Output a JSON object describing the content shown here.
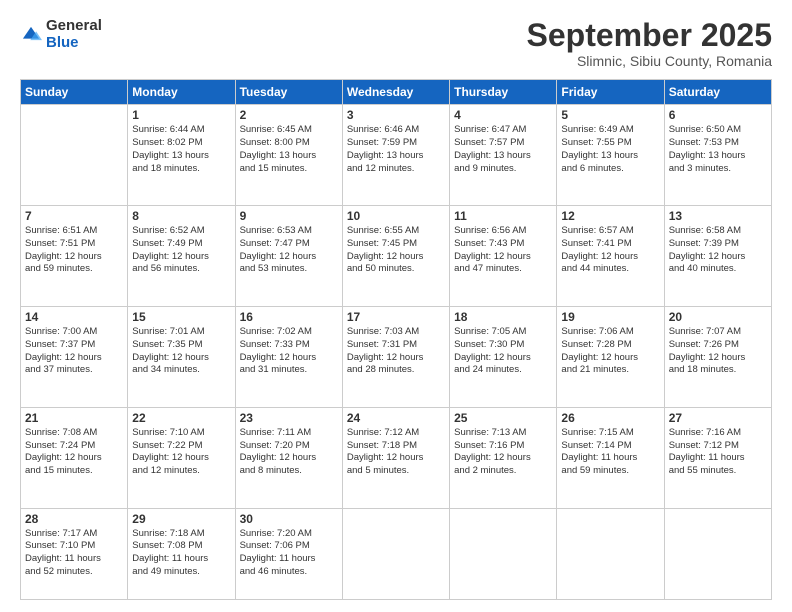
{
  "logo": {
    "general": "General",
    "blue": "Blue"
  },
  "title": "September 2025",
  "location": "Slimnic, Sibiu County, Romania",
  "weekdays": [
    "Sunday",
    "Monday",
    "Tuesday",
    "Wednesday",
    "Thursday",
    "Friday",
    "Saturday"
  ],
  "weeks": [
    [
      {
        "day": "",
        "info": ""
      },
      {
        "day": "1",
        "info": "Sunrise: 6:44 AM\nSunset: 8:02 PM\nDaylight: 13 hours\nand 18 minutes."
      },
      {
        "day": "2",
        "info": "Sunrise: 6:45 AM\nSunset: 8:00 PM\nDaylight: 13 hours\nand 15 minutes."
      },
      {
        "day": "3",
        "info": "Sunrise: 6:46 AM\nSunset: 7:59 PM\nDaylight: 13 hours\nand 12 minutes."
      },
      {
        "day": "4",
        "info": "Sunrise: 6:47 AM\nSunset: 7:57 PM\nDaylight: 13 hours\nand 9 minutes."
      },
      {
        "day": "5",
        "info": "Sunrise: 6:49 AM\nSunset: 7:55 PM\nDaylight: 13 hours\nand 6 minutes."
      },
      {
        "day": "6",
        "info": "Sunrise: 6:50 AM\nSunset: 7:53 PM\nDaylight: 13 hours\nand 3 minutes."
      }
    ],
    [
      {
        "day": "7",
        "info": "Sunrise: 6:51 AM\nSunset: 7:51 PM\nDaylight: 12 hours\nand 59 minutes."
      },
      {
        "day": "8",
        "info": "Sunrise: 6:52 AM\nSunset: 7:49 PM\nDaylight: 12 hours\nand 56 minutes."
      },
      {
        "day": "9",
        "info": "Sunrise: 6:53 AM\nSunset: 7:47 PM\nDaylight: 12 hours\nand 53 minutes."
      },
      {
        "day": "10",
        "info": "Sunrise: 6:55 AM\nSunset: 7:45 PM\nDaylight: 12 hours\nand 50 minutes."
      },
      {
        "day": "11",
        "info": "Sunrise: 6:56 AM\nSunset: 7:43 PM\nDaylight: 12 hours\nand 47 minutes."
      },
      {
        "day": "12",
        "info": "Sunrise: 6:57 AM\nSunset: 7:41 PM\nDaylight: 12 hours\nand 44 minutes."
      },
      {
        "day": "13",
        "info": "Sunrise: 6:58 AM\nSunset: 7:39 PM\nDaylight: 12 hours\nand 40 minutes."
      }
    ],
    [
      {
        "day": "14",
        "info": "Sunrise: 7:00 AM\nSunset: 7:37 PM\nDaylight: 12 hours\nand 37 minutes."
      },
      {
        "day": "15",
        "info": "Sunrise: 7:01 AM\nSunset: 7:35 PM\nDaylight: 12 hours\nand 34 minutes."
      },
      {
        "day": "16",
        "info": "Sunrise: 7:02 AM\nSunset: 7:33 PM\nDaylight: 12 hours\nand 31 minutes."
      },
      {
        "day": "17",
        "info": "Sunrise: 7:03 AM\nSunset: 7:31 PM\nDaylight: 12 hours\nand 28 minutes."
      },
      {
        "day": "18",
        "info": "Sunrise: 7:05 AM\nSunset: 7:30 PM\nDaylight: 12 hours\nand 24 minutes."
      },
      {
        "day": "19",
        "info": "Sunrise: 7:06 AM\nSunset: 7:28 PM\nDaylight: 12 hours\nand 21 minutes."
      },
      {
        "day": "20",
        "info": "Sunrise: 7:07 AM\nSunset: 7:26 PM\nDaylight: 12 hours\nand 18 minutes."
      }
    ],
    [
      {
        "day": "21",
        "info": "Sunrise: 7:08 AM\nSunset: 7:24 PM\nDaylight: 12 hours\nand 15 minutes."
      },
      {
        "day": "22",
        "info": "Sunrise: 7:10 AM\nSunset: 7:22 PM\nDaylight: 12 hours\nand 12 minutes."
      },
      {
        "day": "23",
        "info": "Sunrise: 7:11 AM\nSunset: 7:20 PM\nDaylight: 12 hours\nand 8 minutes."
      },
      {
        "day": "24",
        "info": "Sunrise: 7:12 AM\nSunset: 7:18 PM\nDaylight: 12 hours\nand 5 minutes."
      },
      {
        "day": "25",
        "info": "Sunrise: 7:13 AM\nSunset: 7:16 PM\nDaylight: 12 hours\nand 2 minutes."
      },
      {
        "day": "26",
        "info": "Sunrise: 7:15 AM\nSunset: 7:14 PM\nDaylight: 11 hours\nand 59 minutes."
      },
      {
        "day": "27",
        "info": "Sunrise: 7:16 AM\nSunset: 7:12 PM\nDaylight: 11 hours\nand 55 minutes."
      }
    ],
    [
      {
        "day": "28",
        "info": "Sunrise: 7:17 AM\nSunset: 7:10 PM\nDaylight: 11 hours\nand 52 minutes."
      },
      {
        "day": "29",
        "info": "Sunrise: 7:18 AM\nSunset: 7:08 PM\nDaylight: 11 hours\nand 49 minutes."
      },
      {
        "day": "30",
        "info": "Sunrise: 7:20 AM\nSunset: 7:06 PM\nDaylight: 11 hours\nand 46 minutes."
      },
      {
        "day": "",
        "info": ""
      },
      {
        "day": "",
        "info": ""
      },
      {
        "day": "",
        "info": ""
      },
      {
        "day": "",
        "info": ""
      }
    ]
  ]
}
